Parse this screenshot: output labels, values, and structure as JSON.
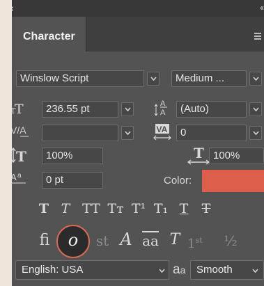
{
  "panel": {
    "close_glyph": "×",
    "collapse_glyph": "‹‹",
    "tab_label": "Character"
  },
  "font": {
    "family": "Winslow Script",
    "style": "Medium ..."
  },
  "size": {
    "font_size": "236.55 pt",
    "leading": "(Auto)"
  },
  "spacing": {
    "kerning": "",
    "tracking": "0"
  },
  "scale": {
    "vertical": "100%",
    "horizontal": "100%"
  },
  "baseline": {
    "shift": "0 pt",
    "color_label": "Color:",
    "color": "#dd5f4b"
  },
  "style_buttons": [
    "T",
    "T",
    "TT",
    "Tт",
    "T¹",
    "T₁",
    "T",
    "T"
  ],
  "opentype_buttons": {
    "ligature": "fi",
    "swash_o": "o",
    "discretionary": "st",
    "swash_A": "A",
    "stylistic": "aa",
    "titling": "T",
    "ordinal_base": "1",
    "ordinal_sup": "st",
    "fraction": "½"
  },
  "language": {
    "value": "English: USA",
    "aa_glyph_big": "a",
    "aa_glyph_small": "a",
    "antialias": "Smooth"
  }
}
